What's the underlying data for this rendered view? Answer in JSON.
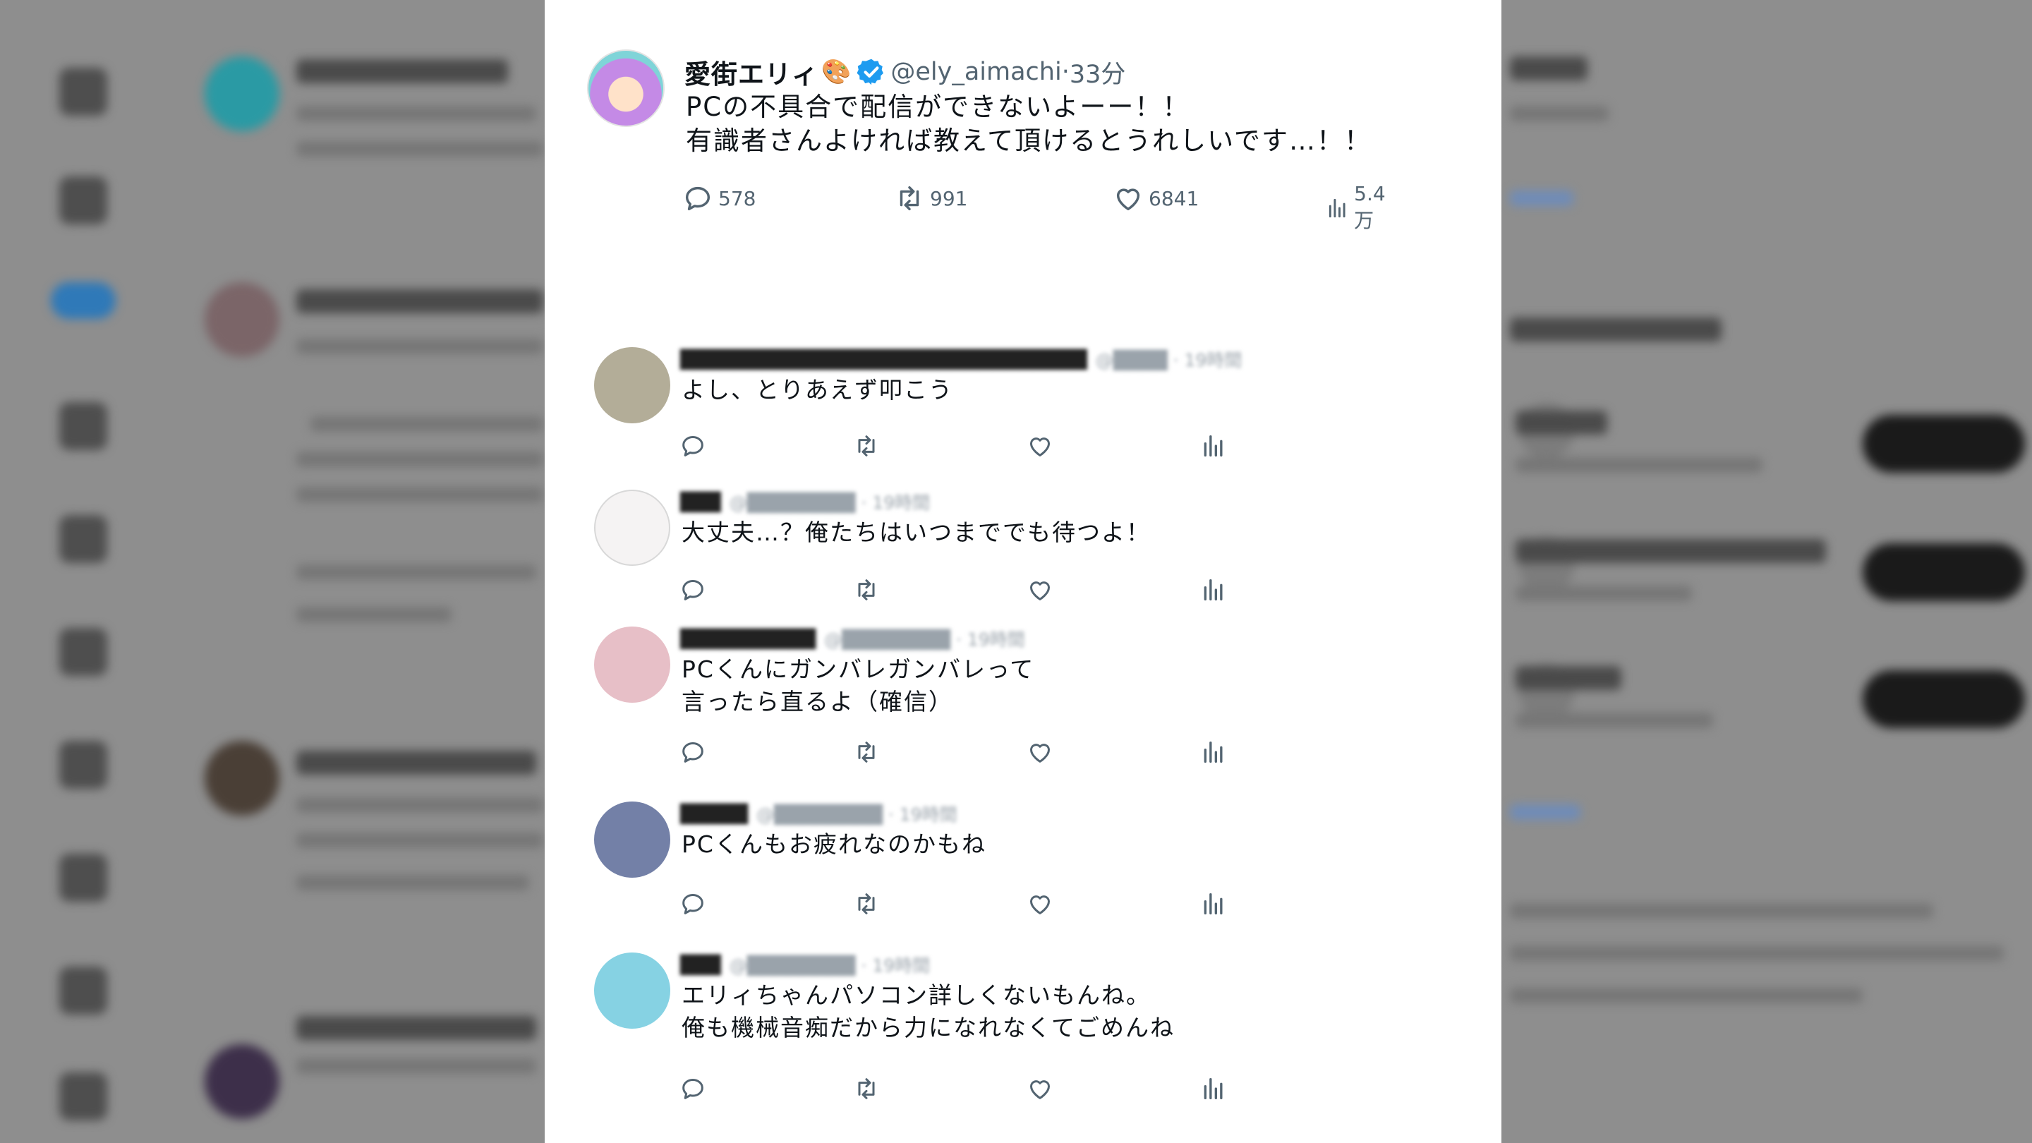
{
  "tweet": {
    "display_name": "愛街エリィ",
    "name_emoji": "🎨",
    "handle": "@ely_aimachi",
    "time": "33分",
    "text": "PCの不具合で配信ができないよーー！！\n有識者さんよければ教えて頂けるとうれしいです…！！",
    "stats": {
      "replies": "578",
      "retweets": "991",
      "likes": "6841",
      "views": "5.4万"
    }
  },
  "replies": [
    {
      "name": "██████████████████████████████",
      "meta": "@████ · 19時間",
      "text": "よし、とりあえず叩こう",
      "avatar_color": "#b3ad98"
    },
    {
      "name": "███",
      "meta": "@████████ · 19時間",
      "text": "大丈夫…？俺たちはいつまででも待つよ！",
      "avatar_color": "#f5f3f3"
    },
    {
      "name": "██████████",
      "meta": "@████████ · 19時間",
      "text": "PCくんにガンバレガンバレって\n言ったら直るよ（確信）",
      "avatar_color": "#e7bfc7"
    },
    {
      "name": "█████",
      "meta": "@████████ · 19時間",
      "text": "PCくんもお疲れなのかもね",
      "avatar_color": "#7380a7"
    },
    {
      "name": "███",
      "meta": "@████████ · 19時間",
      "text": "エリィちゃんパソコン詳しくないもんね。\n俺も機械音痴だから力になれなくてごめんね",
      "avatar_color": "#86d2e3"
    }
  ],
  "colors": {
    "verified": "#1d9bf0",
    "secondary_text": "#536471",
    "panel": "#ffffff"
  },
  "icons": [
    "reply-icon",
    "retweet-icon",
    "like-icon",
    "views-icon",
    "verified-icon",
    "palette-icon"
  ]
}
